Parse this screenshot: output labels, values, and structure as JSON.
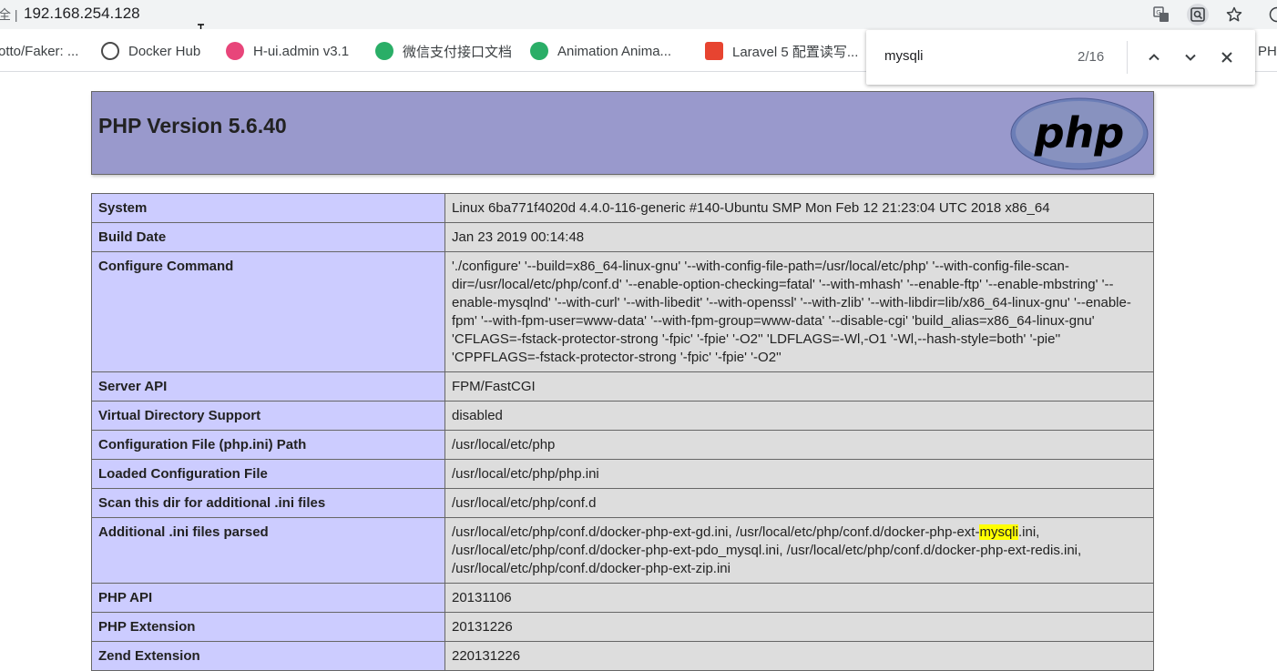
{
  "browser": {
    "address_prefix": "全 |",
    "url": "192.168.254.128",
    "icons": [
      "translate-icon",
      "find-icon",
      "star-icon"
    ]
  },
  "bookmarks": [
    {
      "label": "otto/Faker: ...",
      "icon": ""
    },
    {
      "label": "Docker Hub",
      "icon": "docker-icon",
      "color": "#4a4a4a"
    },
    {
      "label": "H-ui.admin v3.1",
      "icon": "hui-icon",
      "color": "#e8457a"
    },
    {
      "label": "微信支付接口文档",
      "icon": "wechat-icon",
      "color": "#2aae67"
    },
    {
      "label": "Animation Anima...",
      "icon": "wechat-icon",
      "color": "#2aae67"
    },
    {
      "label": "Laravel 5 配置读写...",
      "icon": "laravel-icon",
      "color": "#e74430"
    },
    {
      "label": "PH",
      "icon": ""
    }
  ],
  "find": {
    "query": "mysqli",
    "count": "2/16"
  },
  "php": {
    "title": "PHP Version 5.6.40",
    "logo_text": "php",
    "rows": [
      {
        "key": "System",
        "value": "Linux 6ba771f4020d 4.4.0-116-generic #140-Ubuntu SMP Mon Feb 12 21:23:04 UTC 2018 x86_64"
      },
      {
        "key": "Build Date",
        "value": "Jan 23 2019 00:14:48"
      },
      {
        "key": "Configure Command",
        "value": "'./configure' '--build=x86_64-linux-gnu' '--with-config-file-path=/usr/local/etc/php' '--with-config-file-scan-dir=/usr/local/etc/php/conf.d' '--enable-option-checking=fatal' '--with-mhash' '--enable-ftp' '--enable-mbstring' '--enable-mysqlnd' '--with-curl' '--with-libedit' '--with-openssl' '--with-zlib' '--with-libdir=lib/x86_64-linux-gnu' '--enable-fpm' '--with-fpm-user=www-data' '--with-fpm-group=www-data' '--disable-cgi' 'build_alias=x86_64-linux-gnu' 'CFLAGS=-fstack-protector-strong '-fpic' '-fpie' '-O2'' 'LDFLAGS=-Wl,-O1 '-Wl,--hash-style=both' '-pie'' 'CPPFLAGS=-fstack-protector-strong '-fpic' '-fpie' '-O2''"
      },
      {
        "key": "Server API",
        "value": "FPM/FastCGI"
      },
      {
        "key": "Virtual Directory Support",
        "value": "disabled"
      },
      {
        "key": "Configuration File (php.ini) Path",
        "value": "/usr/local/etc/php"
      },
      {
        "key": "Loaded Configuration File",
        "value": "/usr/local/etc/php/php.ini"
      },
      {
        "key": "Scan this dir for additional .ini files",
        "value": "/usr/local/etc/php/conf.d"
      },
      {
        "key": "Additional .ini files parsed",
        "value_before": "/usr/local/etc/php/conf.d/docker-php-ext-gd.ini, /usr/local/etc/php/conf.d/docker-php-ext-",
        "value_highlight": "mysqli",
        "value_after": ".ini, /usr/local/etc/php/conf.d/docker-php-ext-pdo_mysql.ini, /usr/local/etc/php/conf.d/docker-php-ext-redis.ini, /usr/local/etc/php/conf.d/docker-php-ext-zip.ini"
      },
      {
        "key": "PHP API",
        "value": "20131106"
      },
      {
        "key": "PHP Extension",
        "value": "20131226"
      },
      {
        "key": "Zend Extension",
        "value": "220131226"
      }
    ]
  }
}
